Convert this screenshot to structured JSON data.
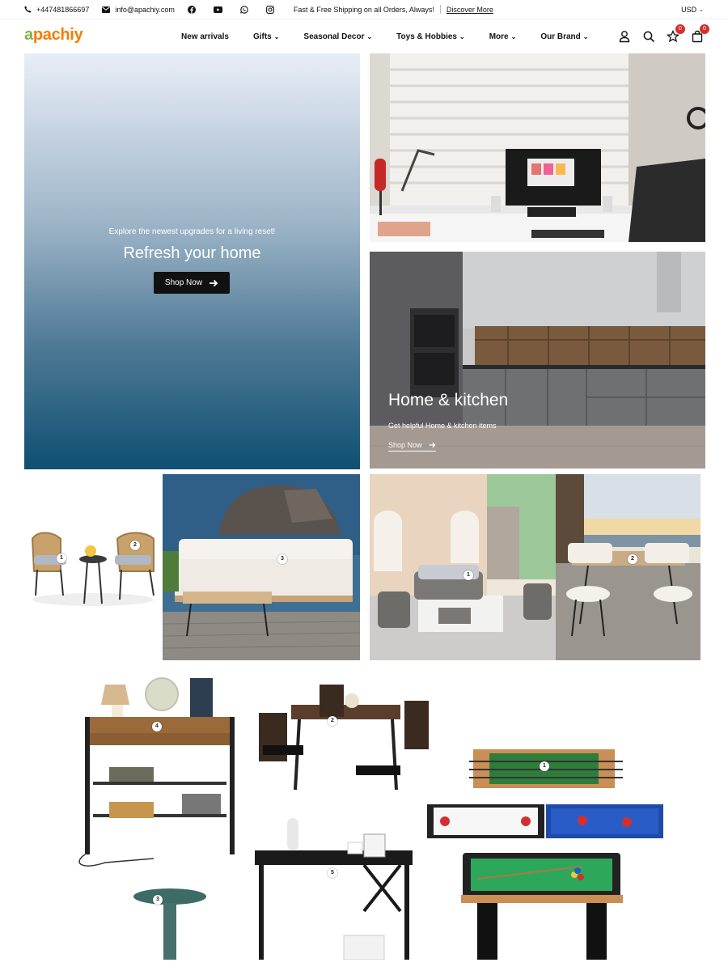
{
  "topbar": {
    "phone": "+447481866697",
    "email": "info@apachiy.com",
    "shipping_text": "Fast & Free Shipping on all Orders, Always!",
    "discover_link": "Discover More",
    "currency": "USD"
  },
  "header": {
    "logo": {
      "part1": "a",
      "part2": "pachiy"
    },
    "nav": [
      {
        "label": "New arrivals",
        "dropdown": false
      },
      {
        "label": "Gifts",
        "dropdown": true
      },
      {
        "label": "Seasonal Decor",
        "dropdown": true
      },
      {
        "label": "Toys & Hobbies",
        "dropdown": true
      },
      {
        "label": "More",
        "dropdown": true
      },
      {
        "label": "Our Brand",
        "dropdown": true
      }
    ],
    "wishlist_count": "0",
    "cart_count": "0"
  },
  "hero": {
    "subtitle": "Explore the newest upgrades for a living reset!",
    "title": "Refresh your home",
    "button": "Shop Now"
  },
  "kitchen_banner": {
    "title": "Home & kitchen",
    "subtitle": "Get helpful Home & kitchen items",
    "link": "Shop Now"
  },
  "hotspots": {
    "patio_left": [
      "1",
      "2",
      "3"
    ],
    "patio_right": [
      "1",
      "2"
    ],
    "furniture": [
      "4",
      "2",
      "1",
      "3",
      "5"
    ]
  },
  "colors": {
    "accent": "#d32f2f",
    "logo_green": "#7cb342",
    "logo_orange": "#f57c00",
    "hero_dark": "#0f4f72"
  }
}
